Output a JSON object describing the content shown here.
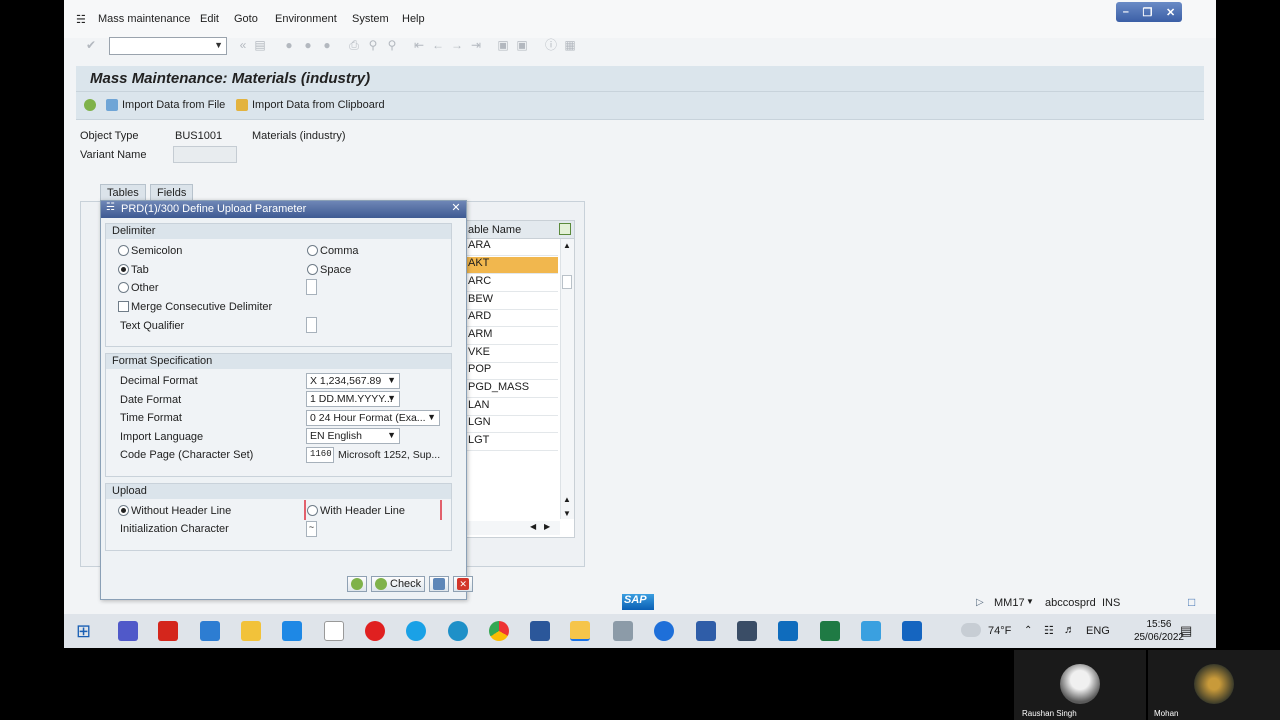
{
  "menubar": {
    "items": [
      "Mass maintenance",
      "Edit",
      "Goto",
      "Environment",
      "System",
      "Help"
    ]
  },
  "title": "Mass Maintenance: Materials (industry)",
  "app_toolbar": {
    "import_file": "Import Data from File",
    "import_clipboard": "Import Data from Clipboard"
  },
  "object": {
    "type_label": "Object Type",
    "type_value": "BUS1001",
    "type_desc": "Materials (industry)",
    "variant_label": "Variant Name"
  },
  "tabs": [
    "Tables",
    "Fields"
  ],
  "table_list": {
    "header": "able Name",
    "rows": [
      "ARA",
      "AKT",
      "ARC",
      "BEW",
      "ARD",
      "ARM",
      "VKE",
      "POP",
      "PGD_MASS",
      "LAN",
      "LGN",
      "LGT"
    ],
    "selected_index": 1
  },
  "dialog": {
    "title": "PRD(1)/300 Define Upload Parameter",
    "delimiter": {
      "heading": "Delimiter",
      "semicolon": "Semicolon",
      "comma": "Comma",
      "tab": "Tab",
      "space": "Space",
      "other": "Other",
      "merge": "Merge Consecutive Delimiter",
      "text_qualifier": "Text Qualifier",
      "selected": "Tab"
    },
    "format": {
      "heading": "Format Specification",
      "decimal_label": "Decimal Format",
      "decimal_value": "X 1,234,567.89",
      "date_label": "Date Format",
      "date_value": "1 DD.MM.YYYY...",
      "time_label": "Time Format",
      "time_value": "0 24 Hour Format (Exa...",
      "language_label": "Import Language",
      "language_value": "EN English",
      "codepage_label": "Code Page (Character Set)",
      "codepage_value": "1160",
      "codepage_desc": "Microsoft 1252, Sup..."
    },
    "upload": {
      "heading": "Upload",
      "without_header": "Without Header Line",
      "with_header": "With Header Line",
      "init_char_label": "Initialization Character",
      "init_char_value": "~",
      "selected": "Without Header Line"
    },
    "buttons": {
      "check": "Check"
    }
  },
  "statusbar": {
    "tcode": "MM17",
    "system": "abccosprd",
    "mode": "INS",
    "logo": "SAP"
  },
  "taskbar": {
    "weather": "74°F",
    "lang": "ENG",
    "time": "15:56",
    "date": "25/06/2022"
  },
  "participants": [
    {
      "name": "Raushan Singh"
    },
    {
      "name": "Mohan"
    }
  ],
  "colors": {
    "selected_row": "#f1b74e",
    "dialog_title": "#3e5a92",
    "header_band": "#dbe5ec"
  }
}
